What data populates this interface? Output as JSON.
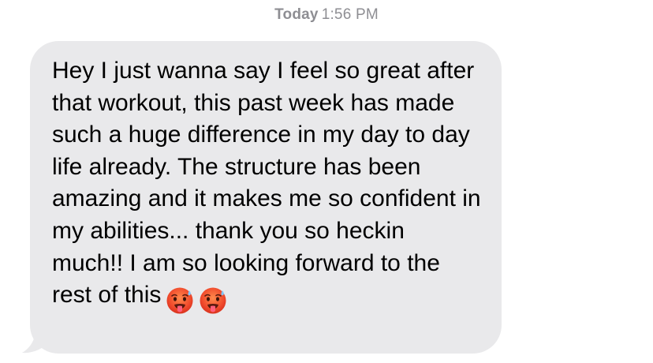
{
  "header": {
    "timestamp_day": "Today",
    "timestamp_time": "1:56 PM"
  },
  "message": {
    "direction": "incoming",
    "bubble_color": "#e9e9eb",
    "text_color": "#000000",
    "text": "Hey I just wanna say I feel so great after that workout, this past week has made such a huge difference in my day to day life already. The structure has been amazing and it makes me so confident in my abilities... thank you so heckin much!! I am so looking forward to the rest of this",
    "emojis": [
      "hot-face-emoji",
      "hot-face-emoji"
    ]
  }
}
